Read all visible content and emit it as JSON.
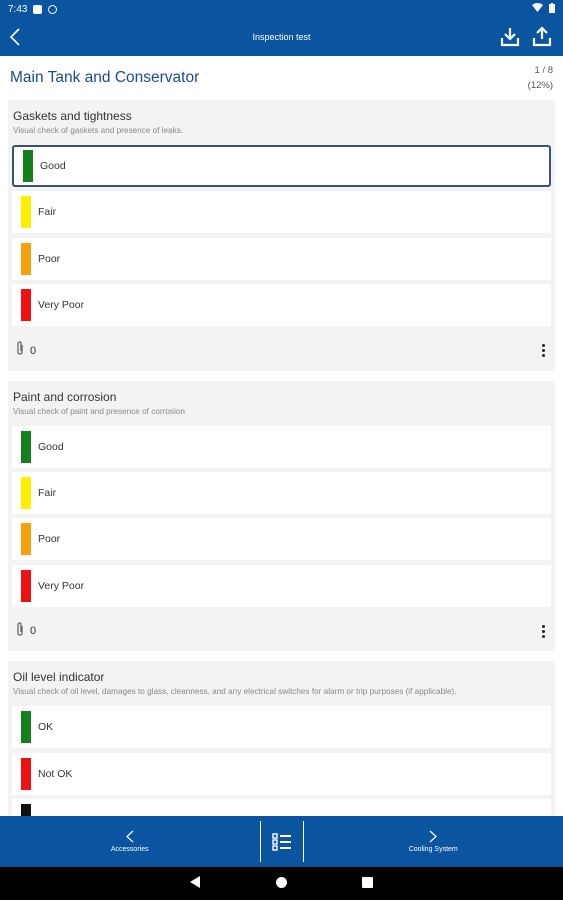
{
  "status_bar": {
    "time": "7:43"
  },
  "app_bar": {
    "title": "Inspection test"
  },
  "page": {
    "title": "Main Tank and Conservator",
    "progress_count": "1 / 8",
    "progress_percent": "(12%)"
  },
  "colors": {
    "primary": "#0b54a0",
    "good": "#13801d",
    "fair": "#ffee00",
    "poor": "#f6a10e",
    "very_poor": "#ee1111"
  },
  "sections": [
    {
      "title": "Gaskets and tightness",
      "description": "Visual check of gaskets and presence of leaks.",
      "options": [
        {
          "label": "Good",
          "color": "#13801d",
          "selected": true
        },
        {
          "label": "Fair",
          "color": "#ffee00",
          "selected": false
        },
        {
          "label": "Poor",
          "color": "#f6a10e",
          "selected": false
        },
        {
          "label": "Very Poor",
          "color": "#ee1111",
          "selected": false
        }
      ],
      "attachments": "0"
    },
    {
      "title": "Paint and corrosion",
      "description": "Visual check of paint and presence of corrosion",
      "options": [
        {
          "label": "Good",
          "color": "#13801d",
          "selected": false
        },
        {
          "label": "Fair",
          "color": "#ffee00",
          "selected": false
        },
        {
          "label": "Poor",
          "color": "#f6a10e",
          "selected": false
        },
        {
          "label": "Very Poor",
          "color": "#ee1111",
          "selected": false
        }
      ],
      "attachments": "0"
    },
    {
      "title": "Oil level indicator",
      "description": "Visual check of oil level, damages to glass, cleanness, and any electrical switches for alarm or trip purposes (if applicable).",
      "options": [
        {
          "label": "OK",
          "color": "#13801d",
          "selected": false
        },
        {
          "label": "Not OK",
          "color": "#ee1111",
          "selected": false
        }
      ]
    }
  ],
  "bottom_nav": {
    "prev_label": "Accessories",
    "next_label": "Cooling System"
  },
  "icons": [
    "chevron-left-icon",
    "download-icon",
    "upload-icon",
    "paperclip-icon",
    "more-vert-icon",
    "checklist-icon",
    "chevron-right-icon"
  ]
}
